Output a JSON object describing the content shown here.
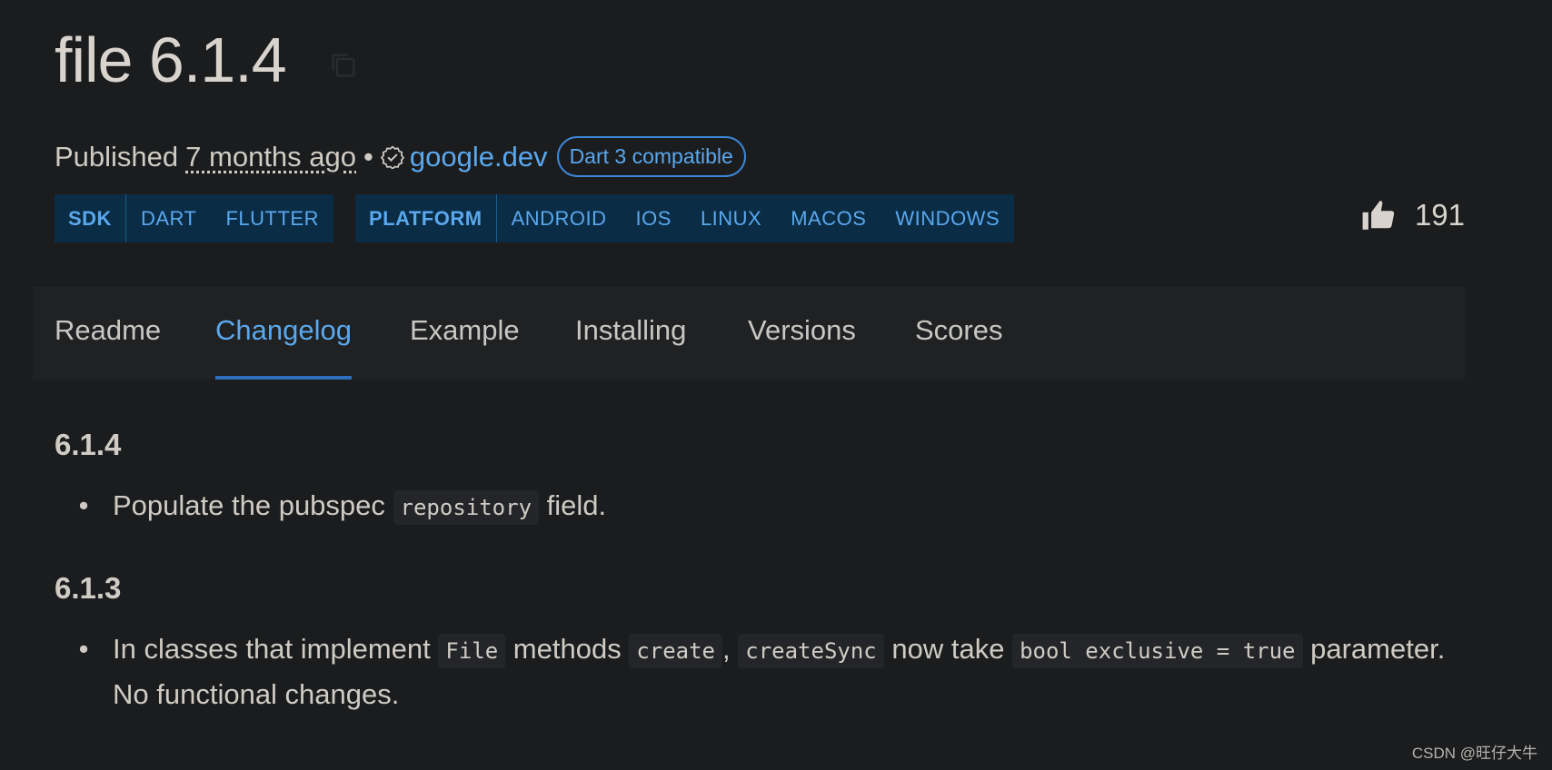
{
  "package": {
    "title": "file 6.1.4"
  },
  "meta": {
    "published_label": "Published",
    "published_ago": "7 months ago",
    "separator": "•",
    "publisher": "google.dev",
    "dart3_badge": "Dart 3 compatible"
  },
  "tags": {
    "sdk_label": "SDK",
    "sdk_items": [
      "DART",
      "FLUTTER"
    ],
    "platform_label": "PLATFORM",
    "platform_items": [
      "ANDROID",
      "IOS",
      "LINUX",
      "MACOS",
      "WINDOWS"
    ]
  },
  "likes": {
    "count": "191"
  },
  "tabs": [
    {
      "label": "Readme"
    },
    {
      "label": "Changelog",
      "active": true
    },
    {
      "label": "Example"
    },
    {
      "label": "Installing"
    },
    {
      "label": "Versions"
    },
    {
      "label": "Scores"
    }
  ],
  "changelog": {
    "v1": {
      "version": "6.1.4",
      "text_a": "Populate the pubspec ",
      "code_a": "repository",
      "text_b": " field."
    },
    "v2": {
      "version": "6.1.3",
      "text_a": "In classes that implement ",
      "code_a": "File",
      "text_b": " methods ",
      "code_b": "create",
      "text_c": ", ",
      "code_c": "createSync",
      "text_d": " now take ",
      "code_d": "bool exclusive = true",
      "text_e": " parameter. No functional changes."
    }
  },
  "watermark": "CSDN @旺仔大牛",
  "colors": {
    "background": "#1b1c1e",
    "accent": "#5aa8ee",
    "tag_background": "#0a2c45"
  }
}
